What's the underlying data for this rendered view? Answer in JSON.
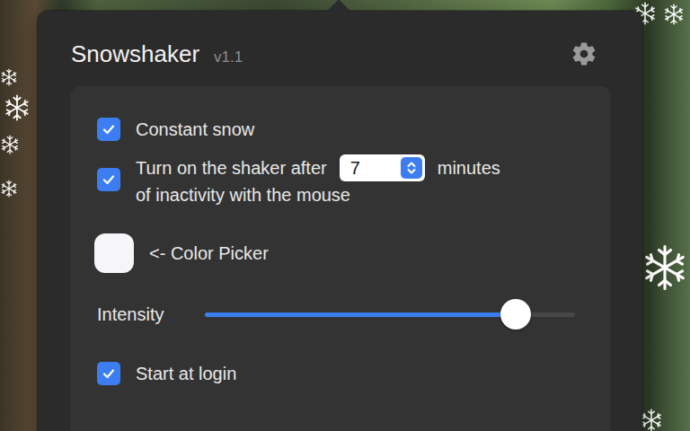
{
  "app": {
    "title": "Snowshaker",
    "version": "v1.1"
  },
  "options": [
    {
      "kind": "checkbox",
      "label": "Constant snow",
      "checked": true
    },
    {
      "kind": "timer",
      "label": "Turn on the shaker after",
      "value": "7",
      "unit": "minutes",
      "label_after": "of inactivity with the mouse",
      "checked": true
    },
    {
      "kind": "color",
      "label": "<- Color Picker",
      "value": "#f6f6f8"
    },
    {
      "kind": "slider",
      "label": "Intensity",
      "level": 0.84
    },
    {
      "kind": "checkbox",
      "label": "Start at login",
      "checked": true
    }
  ]
}
